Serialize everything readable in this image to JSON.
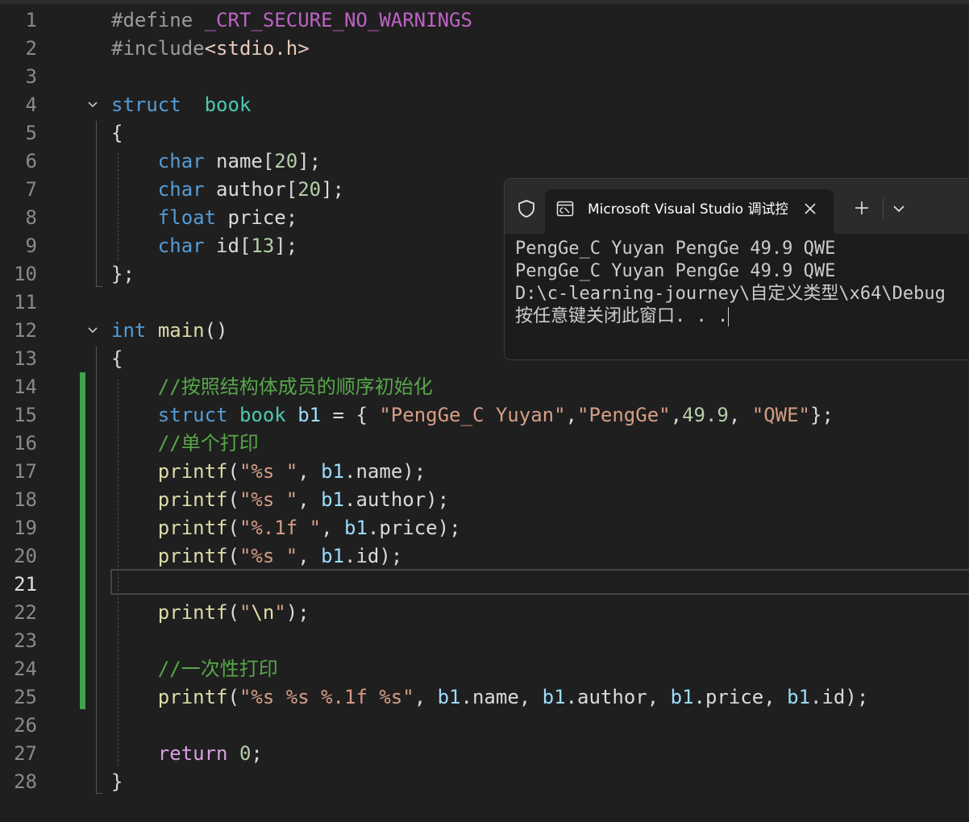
{
  "editor": {
    "current_line": 21,
    "line_numbers": [
      "1",
      "2",
      "3",
      "4",
      "5",
      "6",
      "7",
      "8",
      "9",
      "10",
      "11",
      "12",
      "13",
      "14",
      "15",
      "16",
      "17",
      "18",
      "19",
      "20",
      "21",
      "22",
      "23",
      "24",
      "25",
      "26",
      "27",
      "28"
    ],
    "lines": [
      [
        [
          "pre",
          "#define "
        ],
        [
          "macro",
          "_CRT_SECURE_NO_WARNINGS"
        ]
      ],
      [
        [
          "pre",
          "#include"
        ],
        [
          "inc",
          "<stdio.h>"
        ]
      ],
      [],
      [
        [
          "kw",
          "struct"
        ],
        [
          "",
          "  "
        ],
        [
          "ty",
          "book"
        ]
      ],
      [
        [
          "",
          "{"
        ]
      ],
      [
        [
          "",
          "    "
        ],
        [
          "kw",
          "char"
        ],
        [
          "",
          " name["
        ],
        [
          "num",
          "20"
        ],
        [
          "",
          "];"
        ]
      ],
      [
        [
          "",
          "    "
        ],
        [
          "kw",
          "char"
        ],
        [
          "",
          " author["
        ],
        [
          "num",
          "20"
        ],
        [
          "",
          "];"
        ]
      ],
      [
        [
          "",
          "    "
        ],
        [
          "kw",
          "float"
        ],
        [
          "",
          " price;"
        ]
      ],
      [
        [
          "",
          "    "
        ],
        [
          "kw",
          "char"
        ],
        [
          "",
          " id["
        ],
        [
          "num",
          "13"
        ],
        [
          "",
          "];"
        ]
      ],
      [
        [
          "",
          "};"
        ]
      ],
      [],
      [
        [
          "kw",
          "int"
        ],
        [
          "",
          " "
        ],
        [
          "fn",
          "main"
        ],
        [
          "",
          "()"
        ]
      ],
      [
        [
          "",
          "{"
        ]
      ],
      [
        [
          "",
          "    "
        ],
        [
          "cm",
          "//按照结构体成员的顺序初始化"
        ]
      ],
      [
        [
          "",
          "    "
        ],
        [
          "kw",
          "struct"
        ],
        [
          "",
          " "
        ],
        [
          "ty",
          "book"
        ],
        [
          "",
          " "
        ],
        [
          "var",
          "b1"
        ],
        [
          "",
          " = { "
        ],
        [
          "str",
          "\"PengGe_C Yuyan\""
        ],
        [
          "",
          ","
        ],
        [
          "str",
          "\"PengGe\""
        ],
        [
          "",
          ","
        ],
        [
          "num",
          "49.9"
        ],
        [
          "",
          ", "
        ],
        [
          "str",
          "\"QWE\""
        ],
        [
          "",
          "};"
        ]
      ],
      [
        [
          "",
          "    "
        ],
        [
          "cm",
          "//单个打印"
        ]
      ],
      [
        [
          "",
          "    "
        ],
        [
          "fn",
          "printf"
        ],
        [
          "",
          "("
        ],
        [
          "str",
          "\"%s \""
        ],
        [
          "",
          ", "
        ],
        [
          "var",
          "b1"
        ],
        [
          "",
          ".name);"
        ]
      ],
      [
        [
          "",
          "    "
        ],
        [
          "fn",
          "printf"
        ],
        [
          "",
          "("
        ],
        [
          "str",
          "\"%s \""
        ],
        [
          "",
          ", "
        ],
        [
          "var",
          "b1"
        ],
        [
          "",
          ".author);"
        ]
      ],
      [
        [
          "",
          "    "
        ],
        [
          "fn",
          "printf"
        ],
        [
          "",
          "("
        ],
        [
          "str",
          "\"%.1f \""
        ],
        [
          "",
          ", "
        ],
        [
          "var",
          "b1"
        ],
        [
          "",
          ".price);"
        ]
      ],
      [
        [
          "",
          "    "
        ],
        [
          "fn",
          "printf"
        ],
        [
          "",
          "("
        ],
        [
          "str",
          "\"%s \""
        ],
        [
          "",
          ", "
        ],
        [
          "var",
          "b1"
        ],
        [
          "",
          ".id);"
        ]
      ],
      [],
      [
        [
          "",
          "    "
        ],
        [
          "fn",
          "printf"
        ],
        [
          "",
          "("
        ],
        [
          "str",
          "\""
        ],
        [
          "esc",
          "\\n"
        ],
        [
          "str",
          "\""
        ],
        [
          "",
          ");"
        ]
      ],
      [],
      [
        [
          "",
          "    "
        ],
        [
          "cm",
          "//一次性打印"
        ]
      ],
      [
        [
          "",
          "    "
        ],
        [
          "fn",
          "printf"
        ],
        [
          "",
          "("
        ],
        [
          "str",
          "\"%s %s %.1f %s\""
        ],
        [
          "",
          ", "
        ],
        [
          "var",
          "b1"
        ],
        [
          "",
          ".name, "
        ],
        [
          "var",
          "b1"
        ],
        [
          "",
          ".author, "
        ],
        [
          "var",
          "b1"
        ],
        [
          "",
          ".price, "
        ],
        [
          "var",
          "b1"
        ],
        [
          "",
          ".id);"
        ]
      ],
      [],
      [
        [
          "",
          "    "
        ],
        [
          "ctl",
          "return"
        ],
        [
          "",
          " "
        ],
        [
          "num",
          "0"
        ],
        [
          "",
          ";"
        ]
      ],
      [
        [
          "",
          "}"
        ]
      ]
    ]
  },
  "terminal": {
    "tab_title": "Microsoft Visual Studio 调试控制台",
    "icons": {
      "shield": "shield-icon",
      "tab": "terminal-icon",
      "close": "close-icon",
      "new_tab": "plus-icon",
      "dropdown": "chevron-down-icon"
    },
    "lines": [
      "PengGe_C Yuyan PengGe 49.9 QWE",
      "PengGe_C Yuyan PengGe 49.9 QWE",
      "D:\\c-learning-journey\\自定义类型\\x64\\Debug",
      "按任意键关闭此窗口. . ."
    ]
  },
  "colors": {
    "background": "#1f1f1f",
    "keyword": "#569cd6",
    "type": "#4ec9b0",
    "function": "#dcdcaa",
    "variable": "#9cdcfe",
    "string": "#d69d85",
    "number": "#b5cea8",
    "comment": "#57a64a",
    "modified_bar": "#3fa34d"
  }
}
